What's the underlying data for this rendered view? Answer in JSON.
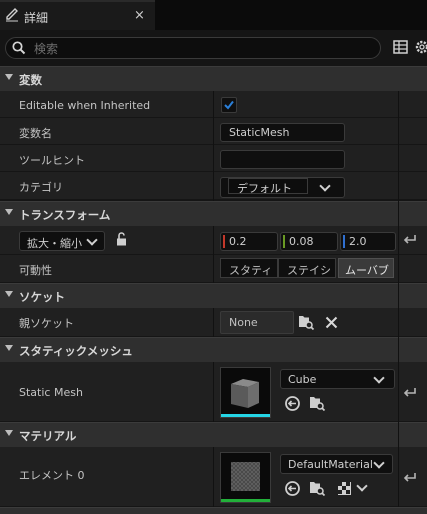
{
  "tab": {
    "title": "詳細",
    "close": "×"
  },
  "search": {
    "placeholder": "検索"
  },
  "sections": {
    "variables": "変数",
    "transform": "トランスフォーム",
    "sockets": "ソケット",
    "static_mesh": "スタティックメッシュ",
    "materials": "マテリアル"
  },
  "variables": {
    "editable_label": "Editable when Inherited",
    "editable_checked": true,
    "name_label": "変数名",
    "name_value": "StaticMesh",
    "tooltip_label": "ツールヒント",
    "tooltip_value": "",
    "category_label": "カテゴリ",
    "category_value": "デフォルト"
  },
  "transform": {
    "scale_dropdown": "拡大・縮小",
    "x": "0.2",
    "y": "0.08",
    "z": "2.0",
    "mobility_label": "可動性",
    "mobility_options": [
      "スタティ",
      "ステイシ",
      "ムーバブ"
    ],
    "mobility_selected": "ムーバブ"
  },
  "sockets": {
    "parent_label": "親ソケット",
    "parent_value": "None"
  },
  "static_mesh": {
    "label": "Static Mesh",
    "value": "Cube"
  },
  "materials": {
    "element_label": "エレメント 0",
    "value": "DefaultMaterial"
  },
  "colors": {
    "accent": "#2a7fd9",
    "x": "#c3382a",
    "y": "#6a9a24",
    "z": "#2f6fcf",
    "mesh_bar": "#25d5e6",
    "mat_bar": "#22b03a"
  }
}
